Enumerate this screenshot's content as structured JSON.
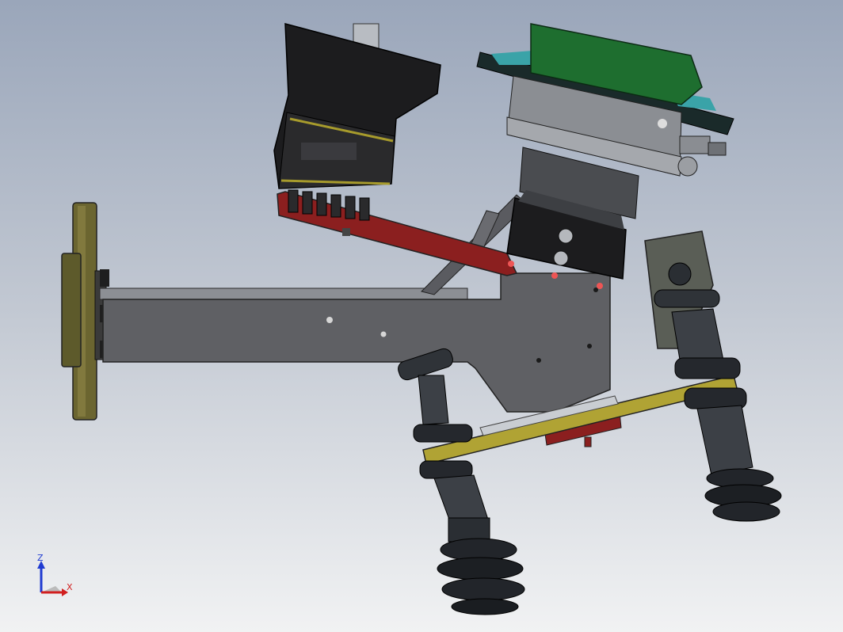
{
  "triad": {
    "z_label": "Z",
    "x_label": "X"
  },
  "colors": {
    "background_top": "#9aa6ba",
    "background_bottom": "#f1f2f3",
    "plate_gray": "#606164",
    "red_plate": "#8b1f1f",
    "green_cover": "#1e6e2f",
    "teal_flange": "#3aa3a8",
    "olive_flange": "#6b6530",
    "yellow_bar": "#b0a334",
    "suction_cup": "#2a2e33"
  }
}
